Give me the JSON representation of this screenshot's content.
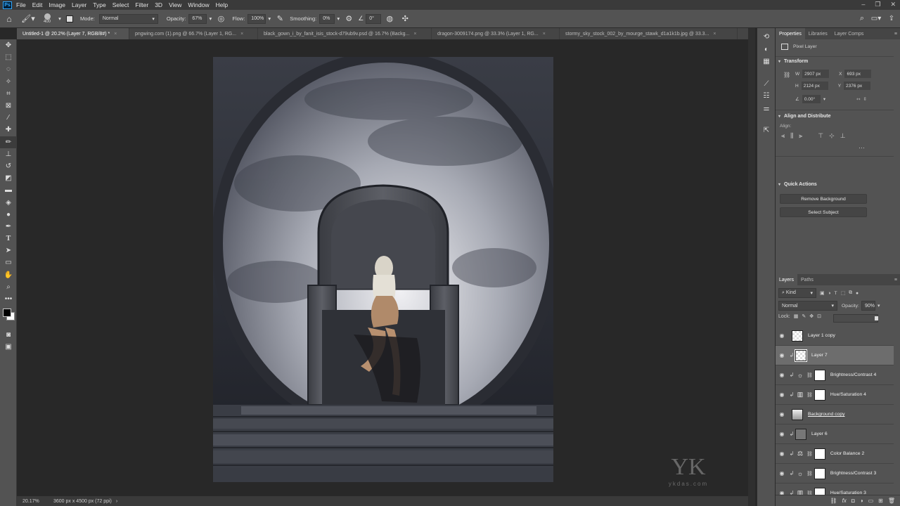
{
  "menu": [
    "File",
    "Edit",
    "Image",
    "Layer",
    "Type",
    "Select",
    "Filter",
    "3D",
    "View",
    "Window",
    "Help"
  ],
  "options": {
    "brush_size": "400",
    "mode_label": "Mode:",
    "mode_value": "Normal",
    "opacity_label": "Opacity:",
    "opacity_value": "67%",
    "flow_label": "Flow:",
    "flow_value": "100%",
    "smoothing_label": "Smoothing:",
    "smoothing_value": "0%",
    "angle_value": "0°"
  },
  "tabs": [
    {
      "label": "Untitled-1 @ 20.2% (Layer 7, RGB/8#) *"
    },
    {
      "label": "pngwing.com (1).png @ 66.7% (Layer 1, RG..."
    },
    {
      "label": "black_gown_i_by_fanit_isis_stock-d79ub9v.psd @ 16.7% (Backg..."
    },
    {
      "label": "dragon-3009174.png @ 33.3% (Layer 1, RG..."
    },
    {
      "label": "stormy_sky_stock_002_by_mourge_stawk_d1a1k1b.jpg @ 33.3..."
    }
  ],
  "status": {
    "zoom": "20.17%",
    "doc_info": "3600 px x 4500 px (72 ppi)"
  },
  "watermark": {
    "brand": "ykdas.com"
  },
  "properties": {
    "tabs": [
      "Properties",
      "Libraries",
      "Layer Comps"
    ],
    "kind": "Pixel Layer",
    "transform_title": "Transform",
    "w": "2907 px",
    "x": "693 px",
    "h": "2124 px",
    "y": "2376 px",
    "angle": "0.00°",
    "align_title": "Align and Distribute",
    "align_label": "Align:",
    "quick_title": "Quick Actions",
    "remove_bg": "Remove Background",
    "select_subject": "Select Subject"
  },
  "layers_panel": {
    "tabs": [
      "Layers",
      "Paths"
    ],
    "kind": "Kind",
    "blend": "Normal",
    "opacity_label": "Opacity:",
    "opacity_value": "90%",
    "lock_label": "Lock:",
    "layers": [
      {
        "name": "Layer 1 copy",
        "type": "pixel"
      },
      {
        "name": "Layer 7",
        "type": "pixel"
      },
      {
        "name": "Brightness/Contrast 4",
        "type": "brightness"
      },
      {
        "name": "Hue/Saturation 4",
        "type": "hue"
      },
      {
        "name": "Background copy",
        "type": "pixel"
      },
      {
        "name": "Layer 6",
        "type": "pixel"
      },
      {
        "name": "Color Balance 2",
        "type": "balance"
      },
      {
        "name": "Brightness/Contrast 3",
        "type": "brightness"
      },
      {
        "name": "Hue/Saturation 3",
        "type": "hue"
      }
    ]
  }
}
